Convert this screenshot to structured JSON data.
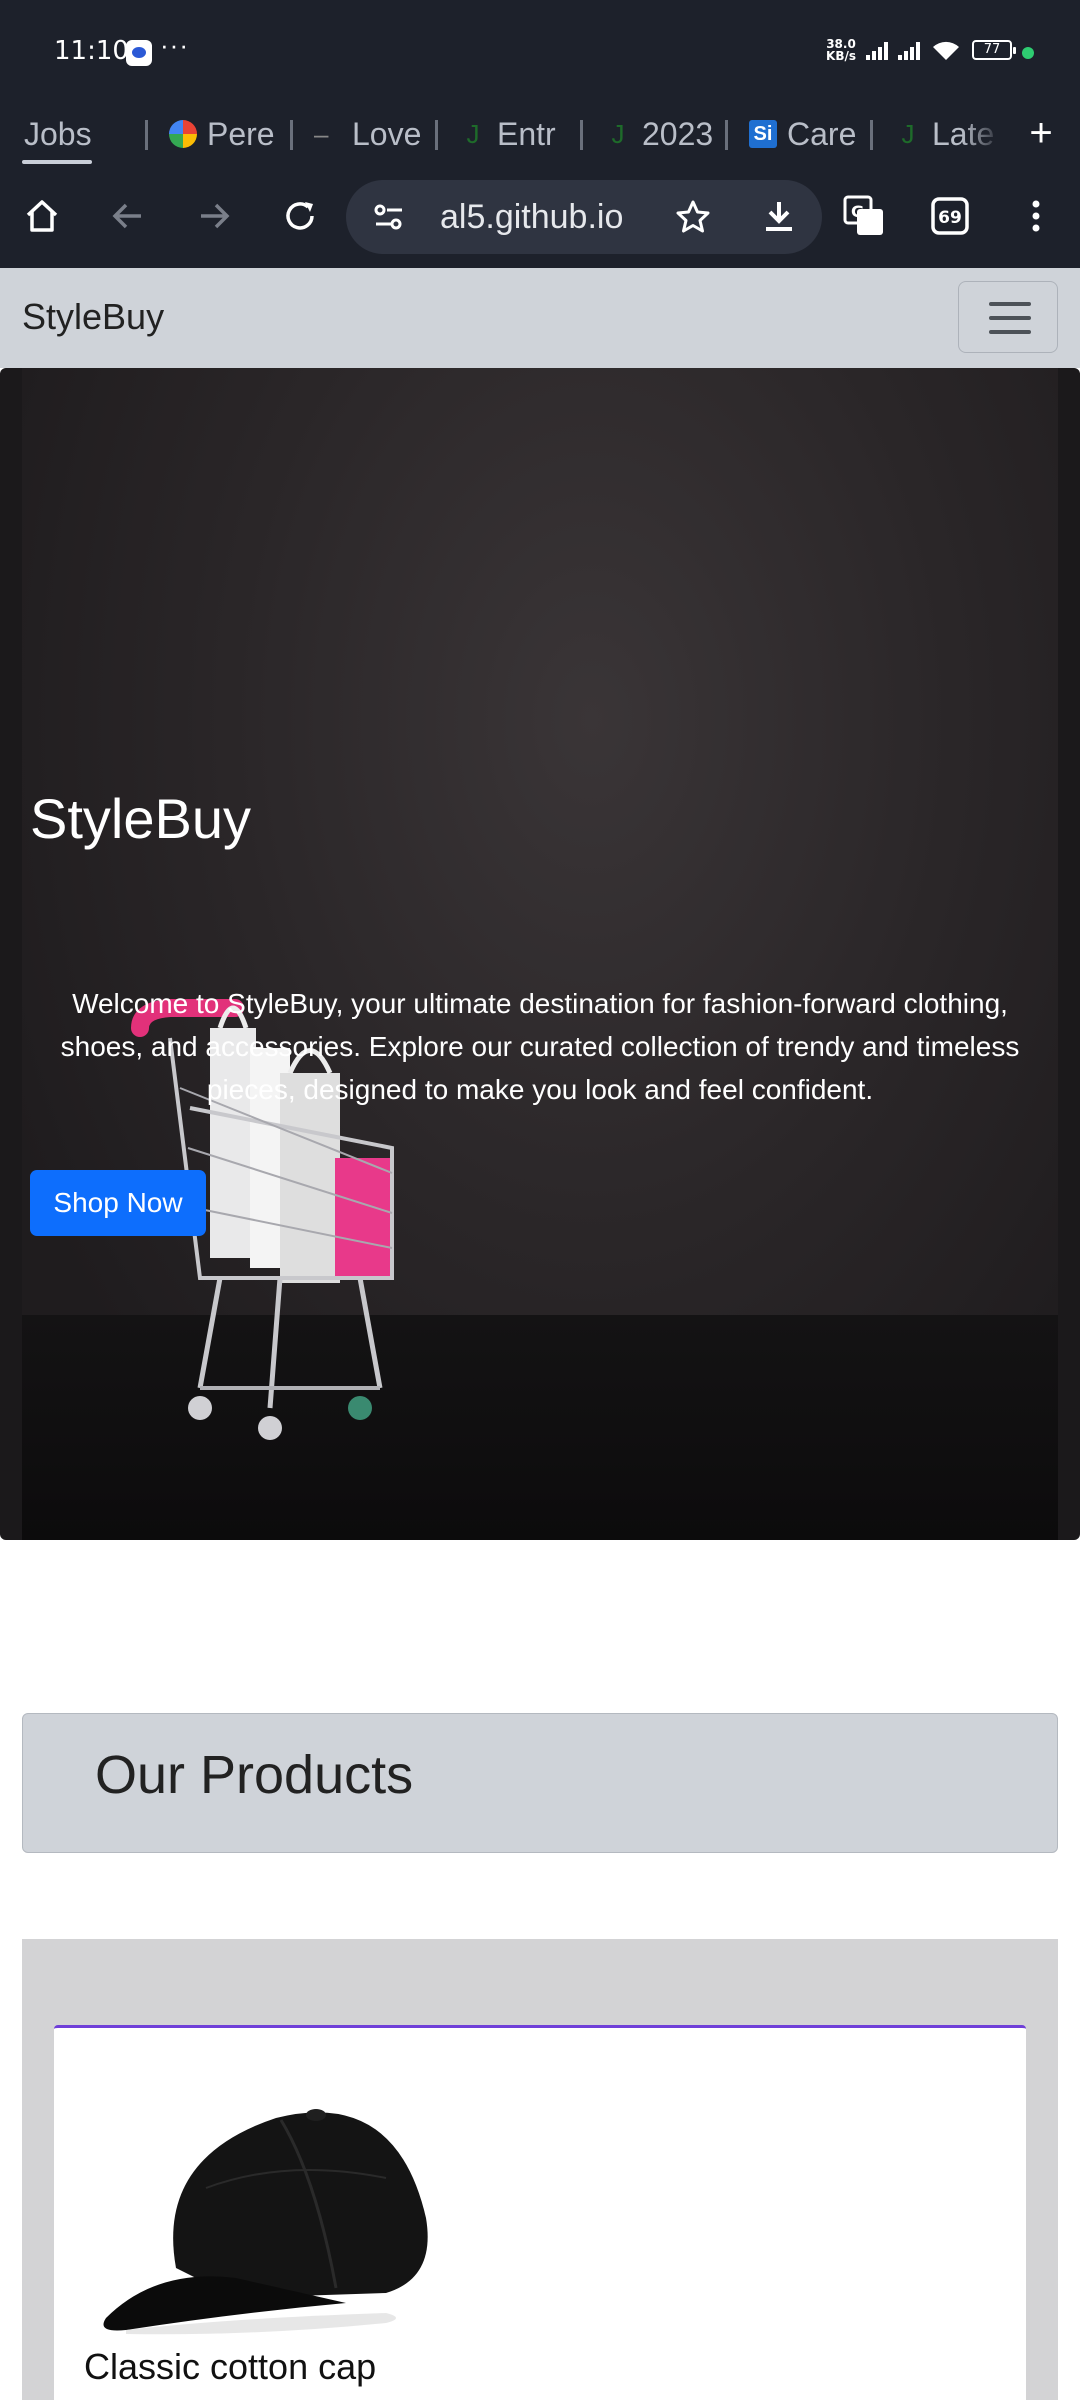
{
  "status_bar": {
    "time": "11:10",
    "overflow": "···",
    "net_speed_value": "38.0",
    "net_speed_unit": "KB/s",
    "battery": "77"
  },
  "browser": {
    "tabs": [
      {
        "label": "Jobs",
        "icon": "job-icon"
      },
      {
        "label": "Pere",
        "icon": "google-icon"
      },
      {
        "label": "Love",
        "icon": "dash-icon"
      },
      {
        "label": "Entr",
        "icon": "j-icon"
      },
      {
        "label": "2023",
        "icon": "j-icon"
      },
      {
        "label": "Care",
        "icon": "si-icon"
      },
      {
        "label": "Late",
        "icon": "j-icon"
      }
    ],
    "new_tab": "+",
    "url": "al5.github.io",
    "translate_badge": "G",
    "tab_count": "69"
  },
  "page": {
    "brand": "StyleBuy",
    "hero": {
      "title": "StyleBuy",
      "text": "Welcome to StyleBuy, your ultimate destination for fashion-forward clothing, shoes, and accessories. Explore our curated collection of trendy and timeless pieces, designed to make you look and feel confident.",
      "button": "Shop Now"
    },
    "section_title": "Our Products",
    "products": [
      {
        "name": "Classic cotton cap"
      }
    ]
  }
}
